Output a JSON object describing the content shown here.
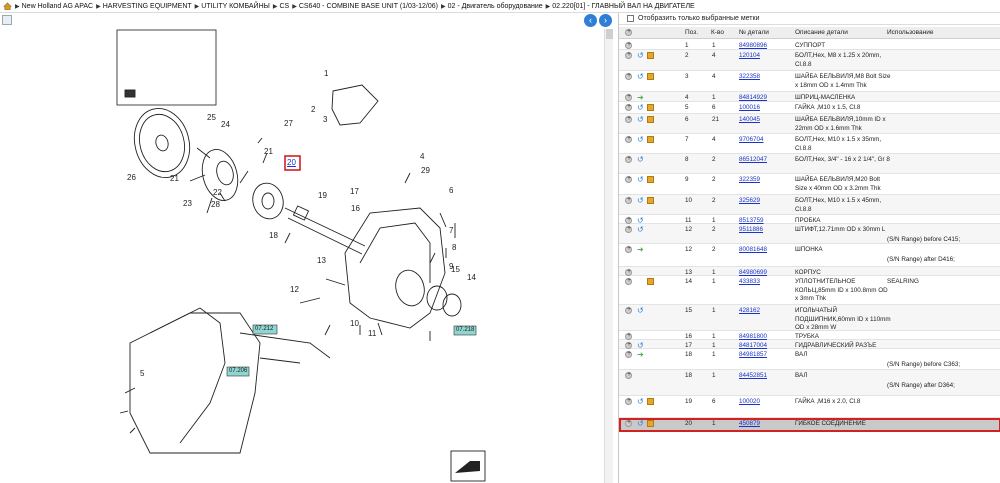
{
  "breadcrumb": {
    "items": [
      "New Holland AG APAC",
      "HARVESTING EQUIPMENT",
      "UTILITY КОМБАЙНЫ",
      "CS",
      "CS640 - COMBINE BASE UNIT (1/03-12/06)",
      "02 - Двигатель оборудование",
      "02.220[01] - ГЛАВНЫЙ ВАЛ НА ДВИГАТЕЛЕ"
    ]
  },
  "filter": {
    "label": "Отобразить только выбранные метки"
  },
  "grid": {
    "headers": {
      "pos": "Поз.",
      "qty": "К-во",
      "part": "№ детали",
      "desc": "Описание детали",
      "use": "Использование"
    },
    "rows": [
      {
        "pos": "1",
        "qty": "1",
        "part": "84980896",
        "desc": "СУППОРТ",
        "use": "",
        "loop": false,
        "arrow": false,
        "box": false
      },
      {
        "pos": "2",
        "qty": "4",
        "part": "120104",
        "desc": "БОЛТ,Hex, M8 x 1.25 x 20mm, Cl.8.8",
        "use": "",
        "loop": true,
        "box": true
      },
      {
        "pos": "3",
        "qty": "4",
        "part": "322358",
        "desc": "ШАЙБА БЕЛЬВИЛЯ,M8 Bolt Size x 18mm OD x 1.4mm Thk",
        "use": "",
        "loop": true,
        "box": true
      },
      {
        "pos": "4",
        "qty": "1",
        "part": "84814929",
        "desc": "ШПРИЦ-МАСЛЕНКА",
        "use": "",
        "arrow": true
      },
      {
        "pos": "5",
        "qty": "6",
        "part": "100016",
        "desc": "ГАЙКА ,M10 x 1.5, Cl.8",
        "use": "",
        "loop": true,
        "box": true
      },
      {
        "pos": "6",
        "qty": "21",
        "part": "140045",
        "desc": "ШАЙБА БЕЛЬВИЛЯ,10mm ID x 22mm OD x 1.6mm Thk",
        "use": "",
        "loop": true,
        "box": true
      },
      {
        "pos": "7",
        "qty": "4",
        "part": "9706704",
        "desc": "БОЛТ,Hex, M10 x 1.5 x 35mm, Cl.8.8",
        "use": "",
        "loop": true,
        "box": true
      },
      {
        "pos": "8",
        "qty": "2",
        "part": "86512047",
        "desc": "БОЛТ,Hex, 3/4\" - 16 x 2 1/4\", Gr 8",
        "use": "",
        "loop": true
      },
      {
        "pos": "9",
        "qty": "2",
        "part": "322359",
        "desc": "ШАЙБА БЕЛЬВИЛЯ,M20 Bolt Size x 40mm OD x 3.2mm Thk",
        "use": "",
        "loop": true,
        "box": true
      },
      {
        "pos": "10",
        "qty": "2",
        "part": "325629",
        "desc": "БОЛТ,Hex, M10 x 1.5 x 45mm, Cl.8.8",
        "use": "",
        "loop": true,
        "box": true
      },
      {
        "pos": "11",
        "qty": "1",
        "part": "8513759",
        "desc": "ПРОБКА",
        "use": "",
        "loop": true
      },
      {
        "pos": "12",
        "qty": "2",
        "part": "9511886",
        "desc": "ШТИФТ,12.71mm OD x 30mm L",
        "use": "(S/N Range) before C415;",
        "loop": true
      },
      {
        "pos": "12",
        "qty": "2",
        "part": "80081648",
        "desc": "ШПОНКА",
        "use": "(S/N Range) after D416;",
        "arrow": true
      },
      {
        "pos": "13",
        "qty": "1",
        "part": "84980699",
        "desc": "КОРПУС",
        "use": ""
      },
      {
        "pos": "14",
        "qty": "1",
        "part": "433833",
        "desc": "УПЛОТНИТЕЛЬНОЕ КОЛЬЦ,85mm ID x 100.8mm OD x 3mm Thk",
        "use": "SEALRING",
        "box": true
      },
      {
        "pos": "15",
        "qty": "1",
        "part": "428162",
        "desc": "ИГОЛЬЧАТЫЙ ПОДШИПНИК,60mm ID x 110mm OD x 28mm W",
        "use": "",
        "loop": true
      },
      {
        "pos": "16",
        "qty": "1",
        "part": "84981800",
        "desc": "ТРУБКА",
        "use": ""
      },
      {
        "pos": "17",
        "qty": "1",
        "part": "84817004",
        "desc": "ГИДРАВЛИЧЕСКИЙ РАЗЪЕ",
        "use": "",
        "loop": true
      },
      {
        "pos": "18",
        "qty": "1",
        "part": "84981857",
        "desc": "ВАЛ",
        "use": "(S/N Range) before C363;",
        "arrow": true
      },
      {
        "pos": "18",
        "qty": "1",
        "part": "84452851",
        "desc": "ВАЛ",
        "use": "(S/N Range) after D364;"
      },
      {
        "pos": "19",
        "qty": "6",
        "part": "100020",
        "desc": "ГАЙКА ,M16 x 2.0, Cl.8",
        "use": "",
        "loop": true,
        "box": true
      },
      {
        "pos": "20",
        "qty": "1",
        "part": "450879",
        "desc": "ГИБКОЕ СОЕДИНЕНИЕ",
        "use": "",
        "loop": true,
        "box": true,
        "selected": true
      }
    ]
  },
  "diagram": {
    "callouts": [
      "1",
      "2",
      "3",
      "4",
      "5",
      "6",
      "7",
      "8",
      "9",
      "10",
      "11",
      "12",
      "13",
      "14",
      "15",
      "16",
      "17",
      "18",
      "19",
      "20",
      "21",
      "22",
      "23",
      "24",
      "25",
      "26",
      "27",
      "28",
      "29"
    ],
    "selected_callout": "20",
    "ref_tags": [
      "07.212",
      "07.218",
      "07.206"
    ]
  },
  "colors": {
    "link": "#1a33c8",
    "highlight": "#d32020",
    "nav": "#2f7fd6"
  }
}
